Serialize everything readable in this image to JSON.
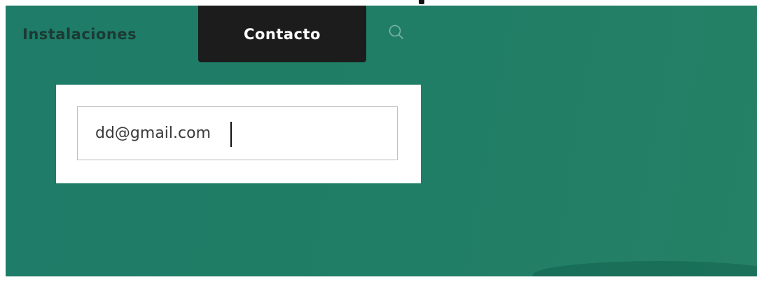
{
  "nav": {
    "items": [
      {
        "label": "Instalaciones",
        "active": false
      },
      {
        "label": "Contacto",
        "active": true
      }
    ],
    "search_icon": "search-icon"
  },
  "form": {
    "email": {
      "value": "dd@gmail.com",
      "placeholder": ""
    }
  },
  "colors": {
    "hero_background": "#1f7d66",
    "active_tab": "#1c1c1c",
    "nav_text": "#1b3a33",
    "active_text": "#ffffff",
    "card_background": "#ffffff"
  }
}
